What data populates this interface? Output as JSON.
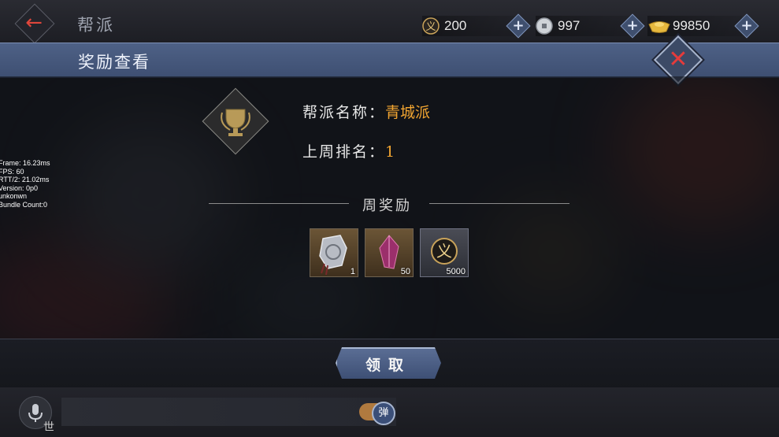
{
  "header": {
    "screen_title": "帮派",
    "currencies": [
      {
        "icon": "righteousness-token-icon",
        "value": "200"
      },
      {
        "icon": "copper-coin-icon",
        "value": "997"
      },
      {
        "icon": "gold-ingot-icon",
        "value": "99850"
      }
    ]
  },
  "dialog": {
    "title": "奖励查看",
    "guild_name_label": "帮派名称：",
    "guild_name_value": "青城派",
    "rank_label": "上周排名：",
    "rank_value": "1",
    "section_title": "周奖励",
    "rewards": [
      {
        "icon": "silver-token-icon",
        "count": "1"
      },
      {
        "icon": "purple-crystal-icon",
        "count": "50"
      },
      {
        "icon": "righteousness-token-icon",
        "count": "5000"
      }
    ],
    "claim_label": "领取"
  },
  "debug": {
    "lines": [
      "Frame: 16.23ms",
      "FPS: 60",
      "RTT/2: 21.02ms",
      "Version: 0p0",
      "unkonwn",
      "Bundle Count:0"
    ]
  },
  "chat": {
    "channel_label": "世",
    "toggle_label": "弹"
  },
  "colors": {
    "accent_gold": "#f2a531",
    "header_blue": "#4e6186",
    "close_red": "#e53b3b"
  }
}
